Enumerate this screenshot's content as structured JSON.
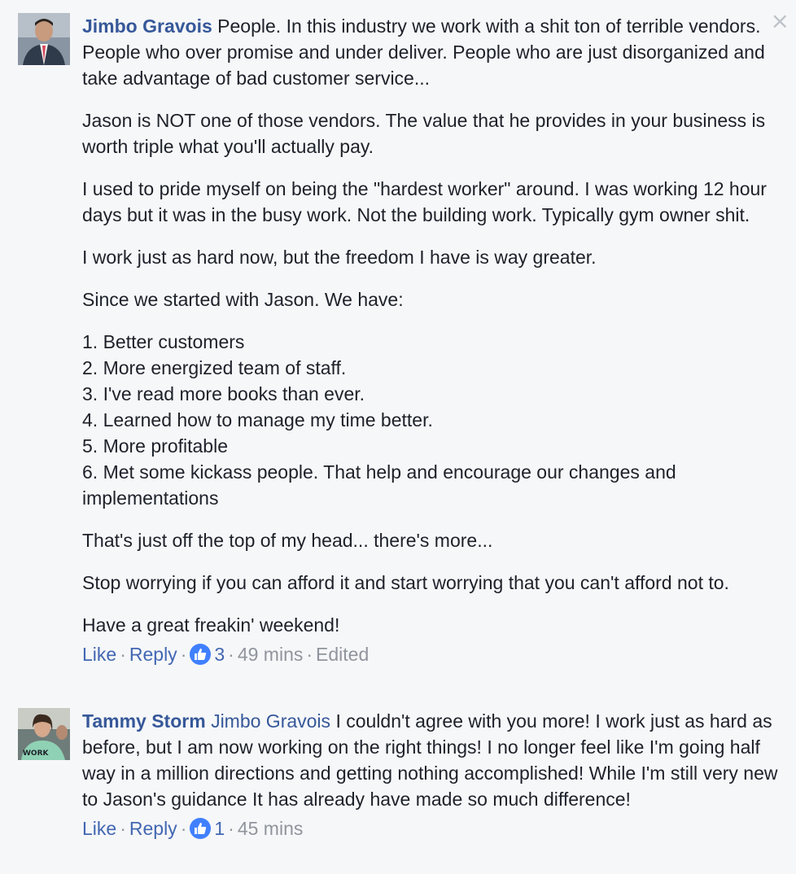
{
  "close_label": "×",
  "comments": [
    {
      "author": "Jimbo Gravois",
      "paragraphs": [
        "People. In this industry we work with a shit ton of terrible vendors. People who over promise and under deliver. People who are just disorganized and take advantage of bad customer service...",
        "Jason is NOT one of those vendors. The value that he provides in your business is worth triple what you'll actually pay.",
        "I used to pride myself on being the \"hardest worker\" around. I was working 12 hour days but it was in the busy work. Not the building work. Typically gym owner shit.",
        "I work just as hard now, but the freedom I have is way greater.",
        "Since we started with Jason. We have:"
      ],
      "list": [
        "1. Better customers",
        "2. More energized team of staff.",
        "3. I've read more books than ever.",
        "4. Learned how to manage my time better.",
        "5. More profitable",
        "6. Met some kickass people. That help and encourage our changes and implementations"
      ],
      "closing": [
        "That's just off the top of my head... there's more...",
        "Stop worrying if you can afford it and start worrying that you can't afford not to.",
        "Have a great freakin' weekend!"
      ],
      "actions": {
        "like": "Like",
        "reply": "Reply",
        "reactions": "3",
        "time": "49 mins",
        "edited": "Edited"
      }
    },
    {
      "author": "Tammy Storm",
      "mention": "Jimbo Gravois",
      "text": "I couldn't agree with you more! I work just as hard as before, but I am now working on the right things! I no longer feel like I'm going half way in a million directions and getting nothing accomplished! While I'm still very new to Jason's guidance It has already have made so much difference!",
      "actions": {
        "like": "Like",
        "reply": "Reply",
        "reactions": "1",
        "time": "45 mins"
      }
    }
  ],
  "colors": {
    "background": "#f6f7f9",
    "link": "#365899",
    "action_link": "#4267b2",
    "meta": "#90949c",
    "like_badge": "#4080ff"
  }
}
